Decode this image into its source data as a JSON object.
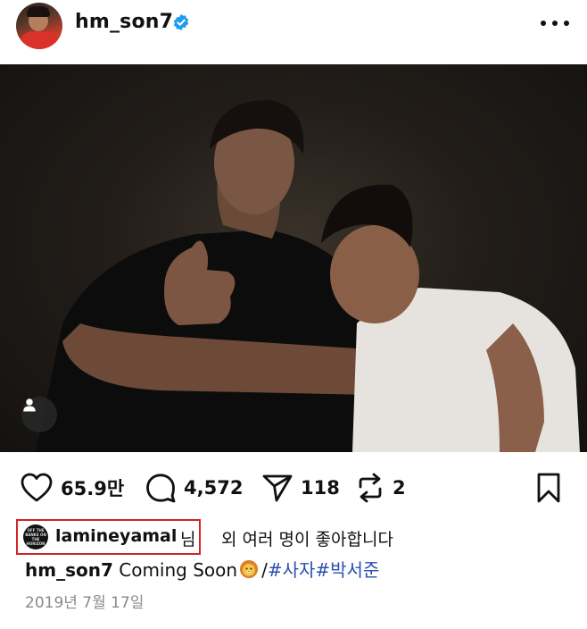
{
  "header": {
    "username": "hm_son7",
    "verified": true,
    "more_icon": "more-horizontal-icon"
  },
  "post": {
    "tag_icon": "person-tag-icon"
  },
  "actions": {
    "likes": "65.9만",
    "comments": "4,572",
    "shares": "118",
    "reposts": "2"
  },
  "liked_by": {
    "avatar_text": "OFF THE BANKS ON THE HORIZON",
    "user": "lamineyamal",
    "suffix": "님",
    "rest": "외 여러 명이 좋아합니다"
  },
  "caption": {
    "user": "hm_son7",
    "text": "Coming Soon",
    "emoji": "lion-face",
    "separator": "/",
    "hashtags": "#사자#박서준"
  },
  "date": "2019년 7월 17일",
  "colors": {
    "verified": "#1d9bf0",
    "highlight_box": "#d2232a",
    "hashtag": "#2a4fb0",
    "date": "#8a8a8a"
  }
}
